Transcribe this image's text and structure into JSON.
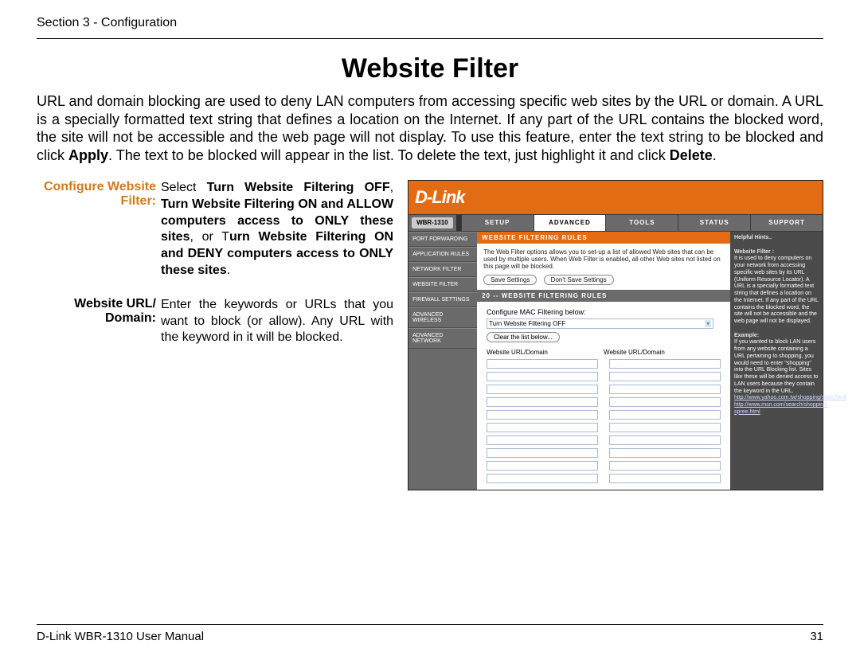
{
  "header": {
    "section": "Section 3 - Configuration"
  },
  "title": "Website Filter",
  "intro": {
    "p1a": "URL and domain blocking are used to deny LAN computers from accessing specific web sites by the URL or domain. A URL is a specially formatted text string that defines a location on the Internet. If any part of the URL contains the blocked word, the site will not be accessible and the web page will not display. To use this feature, enter the text string to be blocked  and click ",
    "apply": "Apply",
    "p1b": ". The text to be blocked  will appear in the list. To delete the text, just highlight it and click ",
    "delete": "Delete",
    "p1c": "."
  },
  "defs": {
    "label1": "Configure Website Filter:",
    "body1_a": "Select ",
    "body1_b": "Turn Website Filtering OFF",
    "body1_c": ", ",
    "body1_d": "Turn Website Filtering ON and ALLOW computers access to ONLY these sites",
    "body1_e": ", or T",
    "body1_f": "urn Website Filtering ON and DENY computers access to ONLY these sites",
    "body1_g": ".",
    "label2": "Website URL/ Domain:",
    "body2": "Enter the keywords or URLs that you want to block (or allow). Any URL with the keyword in it will be blocked."
  },
  "router": {
    "brand": "D-Link",
    "model": "WBR-1310",
    "tabs": [
      "SETUP",
      "ADVANCED",
      "TOOLS",
      "STATUS",
      "SUPPORT"
    ],
    "active_tab": "ADVANCED",
    "sidebar": [
      "PORT FORWARDING",
      "APPLICATION RULES",
      "NETWORK FILTER",
      "WEBSITE FILTER",
      "FIREWALL SETTINGS",
      "ADVANCED WIRELESS",
      "ADVANCED NETWORK"
    ],
    "bar1": "WEBSITE FILTERING RULES",
    "desc": "The Web Filter options allows you to set-up a list of allowed Web sites that can be used by multiple users. When Web Filter is enabled, all other Web sites not listed on this page will be blocked.",
    "btn_save": "Save Settings",
    "btn_dont": "Don't Save Settings",
    "bar2": "20 -- WEBSITE FILTERING RULES",
    "configure_label": "Configure MAC Filtering below:",
    "select_value": "Turn Website Filtering OFF",
    "clear_btn": "Clear the list below...",
    "col1": "Website URL/Domain",
    "col2": "Website URL/Domain",
    "hints_title": "Helpful Hints..",
    "hints_h1": "Website Filter :",
    "hints_p1": "It is used to deny computers on your network from accessing specific web sites by its URL (Uniform Resource Locator). A URL is a specially formatted text string that defines a location on the Internet. If any part of the URL contains the blocked word, the site will not be accessible and the web page will not be displayed.",
    "hints_ex": "Example:",
    "hints_p2": "If you wanted to block LAN users from any website containing a URL pertaining to shopping, you would need to enter \"shopping\" into the URL Blocking list. Sites like these will be denied access to LAN users because they contain the keyword in the URL.",
    "hints_link1": "http://www.yahoo.com.tw/shopping/store.html",
    "hints_link2": "http://www.msn.com/search/shopping-spree.html"
  },
  "footer": {
    "manual": "D-Link WBR-1310 User Manual",
    "page": "31"
  }
}
